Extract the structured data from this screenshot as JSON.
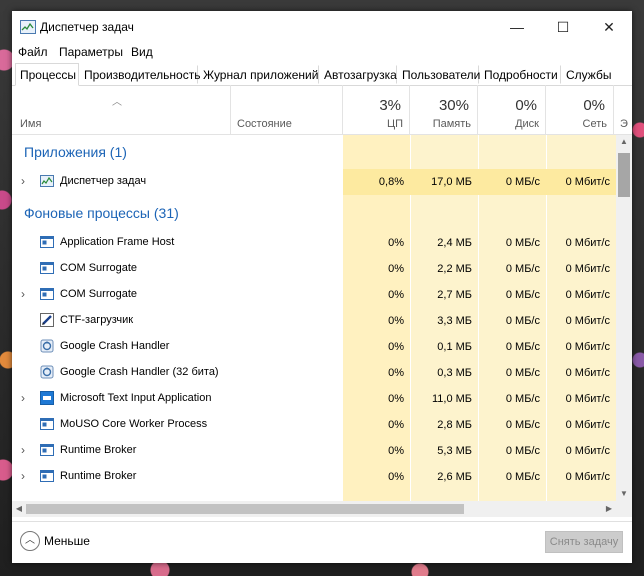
{
  "window": {
    "title": "Диспетчер задач",
    "minimize_glyph": "—",
    "maximize_glyph": "☐",
    "close_glyph": "✕"
  },
  "menu": [
    "Файл",
    "Параметры",
    "Вид"
  ],
  "tabs": [
    {
      "label": "Процессы",
      "active": true
    },
    {
      "label": "Производительность"
    },
    {
      "label": "Журнал приложений"
    },
    {
      "label": "Автозагрузка"
    },
    {
      "label": "Пользователи"
    },
    {
      "label": "Подробности"
    },
    {
      "label": "Службы"
    }
  ],
  "columns": {
    "name": "Имя",
    "status": "Состояние",
    "cpu": {
      "pct": "3%",
      "label": "ЦП"
    },
    "memory": {
      "pct": "30%",
      "label": "Память"
    },
    "disk": {
      "pct": "0%",
      "label": "Диск"
    },
    "network": {
      "pct": "0%",
      "label": "Сеть"
    },
    "more": "Э"
  },
  "groups": {
    "apps": {
      "label": "Приложения (1)",
      "rows": [
        {
          "name": "Диспетчер задач",
          "icon": "taskmgr-icon",
          "expandable": true,
          "cpu": "0,8%",
          "memory": "17,0 МБ",
          "disk": "0 МБ/с",
          "network": "0 Мбит/с",
          "highlight": true
        }
      ]
    },
    "background": {
      "label": "Фоновые процессы (31)",
      "rows": [
        {
          "name": "Application Frame Host",
          "icon": "app-window-icon",
          "expandable": false,
          "cpu": "0%",
          "memory": "2,4 МБ",
          "disk": "0 МБ/с",
          "network": "0 Мбит/с"
        },
        {
          "name": "COM Surrogate",
          "icon": "app-window-icon",
          "expandable": false,
          "cpu": "0%",
          "memory": "2,2 МБ",
          "disk": "0 МБ/с",
          "network": "0 Мбит/с"
        },
        {
          "name": "COM Surrogate",
          "icon": "app-window-icon",
          "expandable": true,
          "cpu": "0%",
          "memory": "2,7 МБ",
          "disk": "0 МБ/с",
          "network": "0 Мбит/с"
        },
        {
          "name": "CTF-загрузчик",
          "icon": "pen-icon",
          "expandable": false,
          "cpu": "0%",
          "memory": "3,3 МБ",
          "disk": "0 МБ/с",
          "network": "0 Мбит/с"
        },
        {
          "name": "Google Crash Handler",
          "icon": "crash-handler-icon",
          "expandable": false,
          "cpu": "0%",
          "memory": "0,1 МБ",
          "disk": "0 МБ/с",
          "network": "0 Мбит/с"
        },
        {
          "name": "Google Crash Handler (32 бита)",
          "icon": "crash-handler-icon",
          "expandable": false,
          "cpu": "0%",
          "memory": "0,3 МБ",
          "disk": "0 МБ/с",
          "network": "0 Мбит/с"
        },
        {
          "name": "Microsoft Text Input Application",
          "icon": "blue-square-icon",
          "expandable": true,
          "cpu": "0%",
          "memory": "11,0 МБ",
          "disk": "0 МБ/с",
          "network": "0 Мбит/с"
        },
        {
          "name": "MoUSO Core Worker Process",
          "icon": "app-window-icon",
          "expandable": false,
          "cpu": "0%",
          "memory": "2,8 МБ",
          "disk": "0 МБ/с",
          "network": "0 Мбит/с"
        },
        {
          "name": "Runtime Broker",
          "icon": "app-window-icon",
          "expandable": true,
          "cpu": "0%",
          "memory": "5,3 МБ",
          "disk": "0 МБ/с",
          "network": "0 Мбит/с"
        },
        {
          "name": "Runtime Broker",
          "icon": "app-window-icon",
          "expandable": true,
          "cpu": "0%",
          "memory": "2,6 МБ",
          "disk": "0 МБ/с",
          "network": "0 Мбит/с"
        }
      ]
    }
  },
  "footer": {
    "less_label": "Меньше",
    "end_task_label": "Снять задачу"
  }
}
